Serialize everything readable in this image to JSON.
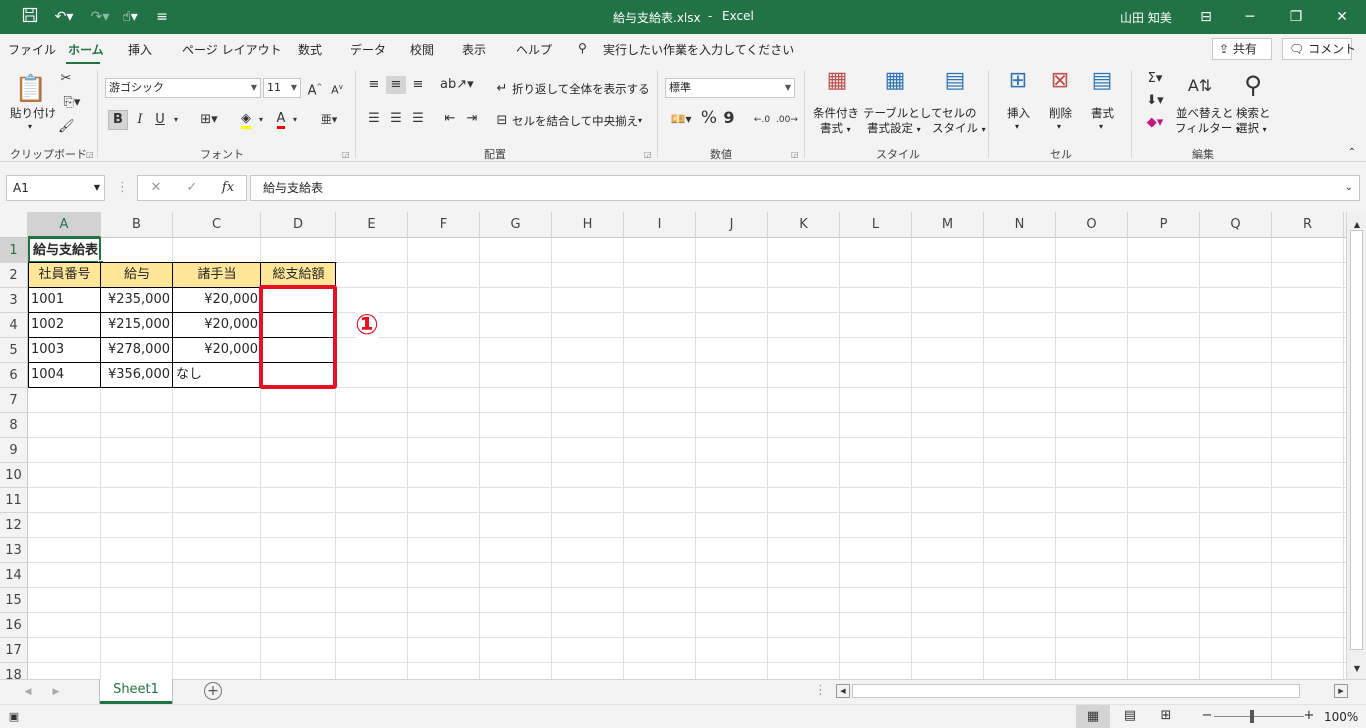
{
  "titlebar": {
    "doc_title": "給与支給表.xlsx",
    "separator": "-",
    "app": "Excel",
    "user": "山田 知美"
  },
  "menu": {
    "tabs": [
      "ファイル",
      "ホーム",
      "挿入",
      "ページ レイアウト",
      "数式",
      "データ",
      "校閲",
      "表示",
      "ヘルプ"
    ],
    "tell_me": "実行したい作業を入力してください",
    "share": "共有",
    "comment": "コメント"
  },
  "ribbon": {
    "clipboard": {
      "paste": "貼り付け",
      "label": "クリップボード"
    },
    "font": {
      "name": "游ゴシック",
      "size": "11",
      "bold": "B",
      "italic": "I",
      "underline": "U",
      "label": "フォント"
    },
    "alignment": {
      "wrap": "折り返して全体を表示する",
      "merge": "セルを結合して中央揃え",
      "label": "配置"
    },
    "number": {
      "format": "標準",
      "percent": "%",
      "comma": "9",
      "label": "数値"
    },
    "styles": {
      "conditional_1": "条件付き",
      "conditional_2": "書式",
      "table_1": "テーブルとして",
      "table_2": "書式設定",
      "cell_1": "セルの",
      "cell_2": "スタイル",
      "label": "スタイル"
    },
    "cells": {
      "insert": "挿入",
      "delete": "削除",
      "format": "書式",
      "label": "セル"
    },
    "editing": {
      "sort_1": "並べ替えと",
      "sort_2": "フィルター",
      "find_1": "検索と",
      "find_2": "選択",
      "label": "編集"
    }
  },
  "formula_bar": {
    "name_box": "A1",
    "fx": "fx",
    "content": "給与支給表"
  },
  "columns": [
    "A",
    "B",
    "C",
    "D",
    "E",
    "F",
    "G",
    "H",
    "I",
    "J",
    "K",
    "L",
    "M",
    "N",
    "O",
    "P",
    "Q",
    "R"
  ],
  "rows": [
    "1",
    "2",
    "3",
    "4",
    "5",
    "6",
    "7",
    "8",
    "9",
    "10",
    "11",
    "12",
    "13",
    "14",
    "15",
    "16",
    "17",
    "18"
  ],
  "sheet": {
    "title": "給与支給表",
    "headers": [
      "社員番号",
      "給与",
      "諸手当",
      "総支給額"
    ],
    "data": [
      [
        "1001",
        "¥235,000",
        "¥20,000",
        ""
      ],
      [
        "1002",
        "¥215,000",
        "¥20,000",
        ""
      ],
      [
        "1003",
        "¥278,000",
        "¥20,000",
        ""
      ],
      [
        "1004",
        "¥356,000",
        "なし",
        ""
      ]
    ]
  },
  "annotation": {
    "marker": "①",
    "highlight_color": "#e81123"
  },
  "tabs": {
    "active": "Sheet1"
  },
  "status": {
    "zoom": "100%"
  }
}
